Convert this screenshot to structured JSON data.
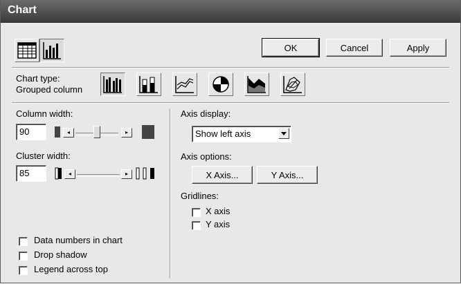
{
  "window": {
    "title": "Chart"
  },
  "view_toolbar": {
    "items": [
      "table-view-icon",
      "chart-view-icon"
    ],
    "selected": "chart-view-icon"
  },
  "buttons": {
    "ok": "OK",
    "cancel": "Cancel",
    "apply": "Apply"
  },
  "chart_type": {
    "label": "Chart type:",
    "current": "Grouped column",
    "types": [
      "grouped-column-icon",
      "stacked-column-icon",
      "line-chart-icon",
      "pie-chart-icon",
      "area-chart-icon",
      "scatter-chart-icon"
    ]
  },
  "column_width": {
    "label": "Column width:",
    "value": "90"
  },
  "cluster_width": {
    "label": "Cluster width:",
    "value": "85"
  },
  "checkboxes": {
    "data_numbers": {
      "label": "Data numbers in chart",
      "checked": false
    },
    "drop_shadow": {
      "label": "Drop shadow",
      "checked": false
    },
    "legend_top": {
      "label": "Legend across top",
      "checked": false
    }
  },
  "axis_display": {
    "label": "Axis display:",
    "selected": "Show left axis"
  },
  "axis_options": {
    "label": "Axis options:",
    "x_button": "X Axis...",
    "y_button": "Y Axis..."
  },
  "gridlines": {
    "label": "Gridlines:",
    "x": {
      "label": "X axis",
      "checked": false
    },
    "y": {
      "label": "Y axis",
      "checked": false
    }
  }
}
